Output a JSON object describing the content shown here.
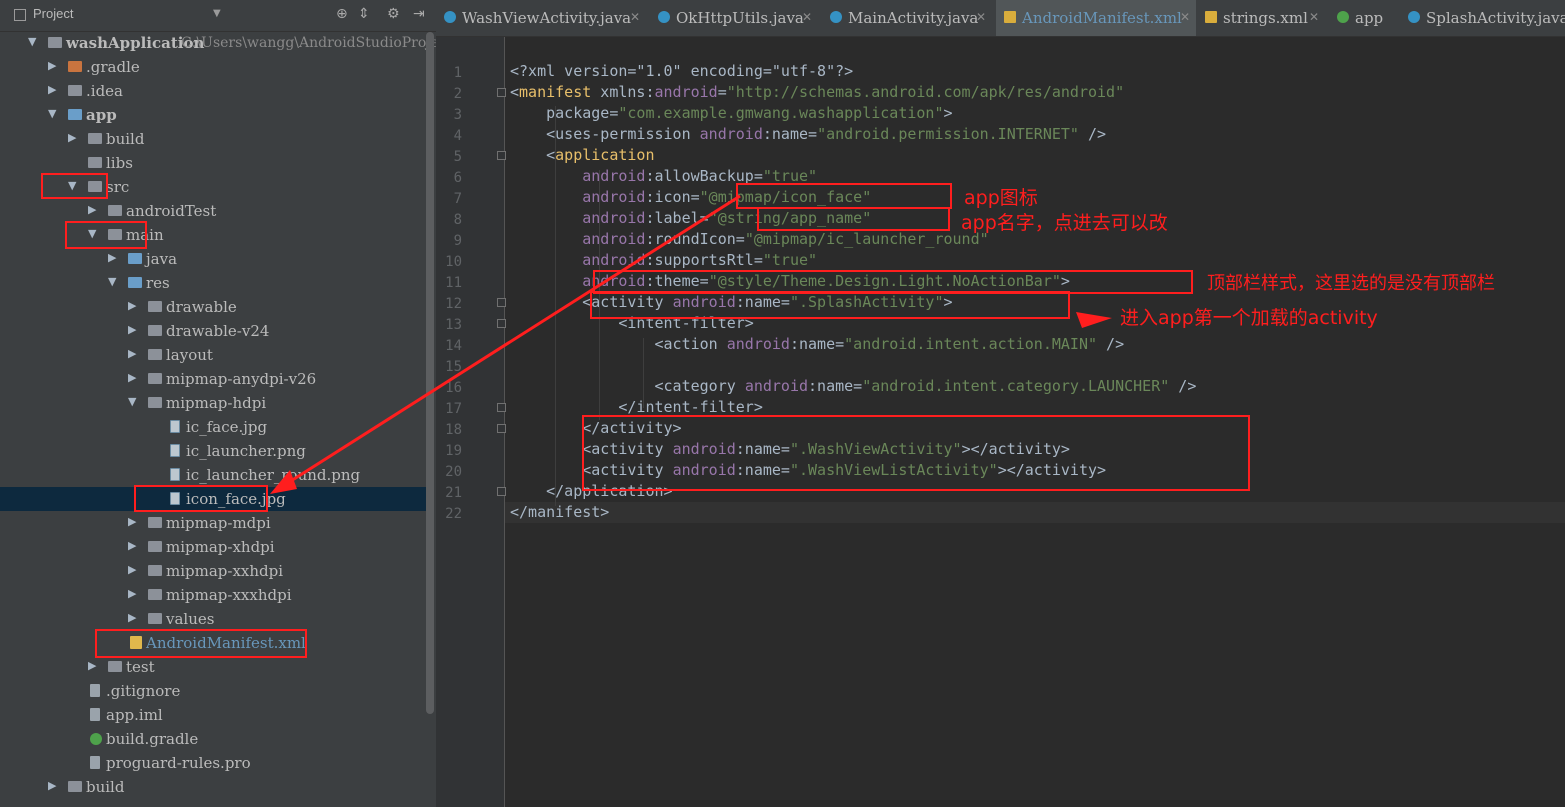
{
  "project_panel": {
    "title": "Project",
    "tree": [
      {
        "label": "washApplication",
        "path": "C:\\Users\\wangg\\AndroidStudioProje",
        "arrow": "▼",
        "icon": "folder",
        "bold": true
      },
      {
        "label": ".gradle",
        "arrow": "▶",
        "icon": "folder-orange"
      },
      {
        "label": ".idea",
        "arrow": "▶",
        "icon": "folder"
      },
      {
        "label": "app",
        "arrow": "▼",
        "icon": "folder-module",
        "bold": true
      },
      {
        "label": "build",
        "arrow": "▶",
        "icon": "folder"
      },
      {
        "label": "libs",
        "arrow": "",
        "icon": "folder"
      },
      {
        "label": "src",
        "arrow": "▼",
        "icon": "folder"
      },
      {
        "label": "androidTest",
        "arrow": "▶",
        "icon": "folder"
      },
      {
        "label": "main",
        "arrow": "▼",
        "icon": "folder"
      },
      {
        "label": "java",
        "arrow": "▶",
        "icon": "folder-blue"
      },
      {
        "label": "res",
        "arrow": "▼",
        "icon": "folder-res"
      },
      {
        "label": "drawable",
        "arrow": "▶",
        "icon": "folder"
      },
      {
        "label": "drawable-v24",
        "arrow": "▶",
        "icon": "folder"
      },
      {
        "label": "layout",
        "arrow": "▶",
        "icon": "folder"
      },
      {
        "label": "mipmap-anydpi-v26",
        "arrow": "▶",
        "icon": "folder"
      },
      {
        "label": "mipmap-hdpi",
        "arrow": "▼",
        "icon": "folder"
      },
      {
        "label": "ic_face.jpg",
        "arrow": "",
        "icon": "image-file"
      },
      {
        "label": "ic_launcher.png",
        "arrow": "",
        "icon": "image-file"
      },
      {
        "label": "ic_launcher_round.png",
        "arrow": "",
        "icon": "image-file"
      },
      {
        "label": "icon_face.jpg",
        "arrow": "",
        "icon": "image-file",
        "selected": true
      },
      {
        "label": "mipmap-mdpi",
        "arrow": "▶",
        "icon": "folder"
      },
      {
        "label": "mipmap-xhdpi",
        "arrow": "▶",
        "icon": "folder"
      },
      {
        "label": "mipmap-xxhdpi",
        "arrow": "▶",
        "icon": "folder"
      },
      {
        "label": "mipmap-xxxhdpi",
        "arrow": "▶",
        "icon": "folder"
      },
      {
        "label": "values",
        "arrow": "▶",
        "icon": "folder"
      },
      {
        "label": "AndroidManifest.xml",
        "arrow": "",
        "icon": "xml-file",
        "blue": true
      },
      {
        "label": "test",
        "arrow": "▶",
        "icon": "folder"
      },
      {
        "label": ".gitignore",
        "arrow": "",
        "icon": "text-file"
      },
      {
        "label": "app.iml",
        "arrow": "",
        "icon": "module-file"
      },
      {
        "label": "build.gradle",
        "arrow": "",
        "icon": "gradle-file"
      },
      {
        "label": "proguard-rules.pro",
        "arrow": "",
        "icon": "text-file"
      },
      {
        "label": "build",
        "arrow": "▶",
        "icon": "folder"
      }
    ]
  },
  "tabs": [
    {
      "label": "WashViewActivity.java",
      "icon": "java-class-icon"
    },
    {
      "label": "OkHttpUtils.java",
      "icon": "java-class-icon"
    },
    {
      "label": "MainActivity.java",
      "icon": "java-class-icon"
    },
    {
      "label": "AndroidManifest.xml",
      "icon": "xml-file-icon",
      "active": true
    },
    {
      "label": "strings.xml",
      "icon": "xml-file-icon"
    },
    {
      "label": "app",
      "icon": "gradle-icon"
    },
    {
      "label": "SplashActivity.java",
      "icon": "java-class-icon"
    }
  ],
  "editor": {
    "line_numbers": [
      "1",
      "2",
      "3",
      "4",
      "5",
      "6",
      "7",
      "8",
      "9",
      "10",
      "11",
      "12",
      "13",
      "14",
      "15",
      "16",
      "17",
      "18",
      "19",
      "20",
      "21",
      "22"
    ],
    "lines": [
      [
        [
          "plain",
          "<?xml version=\"1.0\" encoding=\"utf-8\"?>"
        ]
      ],
      [
        [
          "plain",
          "<"
        ],
        [
          "tag",
          "manifest"
        ],
        [
          "plain",
          " xmlns:"
        ],
        [
          "ns",
          "android"
        ],
        [
          "plain",
          "="
        ],
        [
          "str",
          "\"http://schemas.android.com/apk/res/android\""
        ]
      ],
      [
        [
          "plain",
          "    package="
        ],
        [
          "str",
          "\"com.example.gmwang.washapplication\""
        ],
        [
          "plain",
          ">"
        ]
      ],
      [
        [
          "plain",
          "    <uses-permission "
        ],
        [
          "ns",
          "android"
        ],
        [
          "plain",
          ":name="
        ],
        [
          "str",
          "\"android.permission.INTERNET\""
        ],
        [
          "plain",
          " />"
        ]
      ],
      [
        [
          "plain",
          "    <"
        ],
        [
          "tag",
          "application"
        ]
      ],
      [
        [
          "plain",
          "        "
        ],
        [
          "ns",
          "android"
        ],
        [
          "plain",
          ":allowBackup="
        ],
        [
          "str",
          "\"true\""
        ]
      ],
      [
        [
          "plain",
          "        "
        ],
        [
          "ns",
          "android"
        ],
        [
          "plain",
          ":icon="
        ],
        [
          "str",
          "\"@mipmap/icon_face\""
        ]
      ],
      [
        [
          "plain",
          "        "
        ],
        [
          "ns",
          "android"
        ],
        [
          "plain",
          ":label="
        ],
        [
          "str",
          "\"@string/app_name\""
        ]
      ],
      [
        [
          "plain",
          "        "
        ],
        [
          "ns",
          "android"
        ],
        [
          "plain",
          ":roundIcon="
        ],
        [
          "str",
          "\"@mipmap/ic_launcher_round\""
        ]
      ],
      [
        [
          "plain",
          "        "
        ],
        [
          "ns",
          "android"
        ],
        [
          "plain",
          ":supportsRtl="
        ],
        [
          "str",
          "\"true\""
        ]
      ],
      [
        [
          "plain",
          "        "
        ],
        [
          "ns",
          "android"
        ],
        [
          "plain",
          ":theme="
        ],
        [
          "str",
          "\"@style/Theme.Design.Light.NoActionBar\""
        ],
        [
          "plain",
          ">"
        ]
      ],
      [
        [
          "plain",
          "        <activity "
        ],
        [
          "ns",
          "android"
        ],
        [
          "plain",
          ":name="
        ],
        [
          "str",
          "\".SplashActivity\""
        ],
        [
          "plain",
          ">"
        ]
      ],
      [
        [
          "plain",
          "            <intent-filter>"
        ]
      ],
      [
        [
          "plain",
          "                <action "
        ],
        [
          "ns",
          "android"
        ],
        [
          "plain",
          ":name="
        ],
        [
          "str",
          "\"android.intent.action.MAIN\""
        ],
        [
          "plain",
          " />"
        ]
      ],
      [
        [
          "plain",
          ""
        ]
      ],
      [
        [
          "plain",
          "                <category "
        ],
        [
          "ns",
          "android"
        ],
        [
          "plain",
          ":name="
        ],
        [
          "str",
          "\"android.intent.category.LAUNCHER\""
        ],
        [
          "plain",
          " />"
        ]
      ],
      [
        [
          "plain",
          "            </intent-filter>"
        ]
      ],
      [
        [
          "plain",
          "        </activity>"
        ]
      ],
      [
        [
          "plain",
          "        <activity "
        ],
        [
          "ns",
          "android"
        ],
        [
          "plain",
          ":name="
        ],
        [
          "str",
          "\".WashViewActivity\""
        ],
        [
          "plain",
          "></activity>"
        ]
      ],
      [
        [
          "plain",
          "        <activity "
        ],
        [
          "ns",
          "android"
        ],
        [
          "plain",
          ":name="
        ],
        [
          "str",
          "\".WashViewListActivity\""
        ],
        [
          "plain",
          "></activity>"
        ]
      ],
      [
        [
          "plain",
          "    </application>"
        ]
      ],
      [
        [
          "plain",
          "</manifest>"
        ]
      ]
    ]
  },
  "annotations": {
    "icon_note": "app图标",
    "label_note": "app名字，点进去可以改",
    "theme_note": "顶部栏样式，这里选的是没有顶部栏",
    "activity_note": "进入app第一个加载的activity"
  },
  "colors": {
    "annotation_red": "#ff1e1e",
    "xml_tag": "#e8bf6a",
    "xml_namespace": "#9876aa",
    "xml_string": "#6a8759",
    "selection": "#0d293e"
  }
}
